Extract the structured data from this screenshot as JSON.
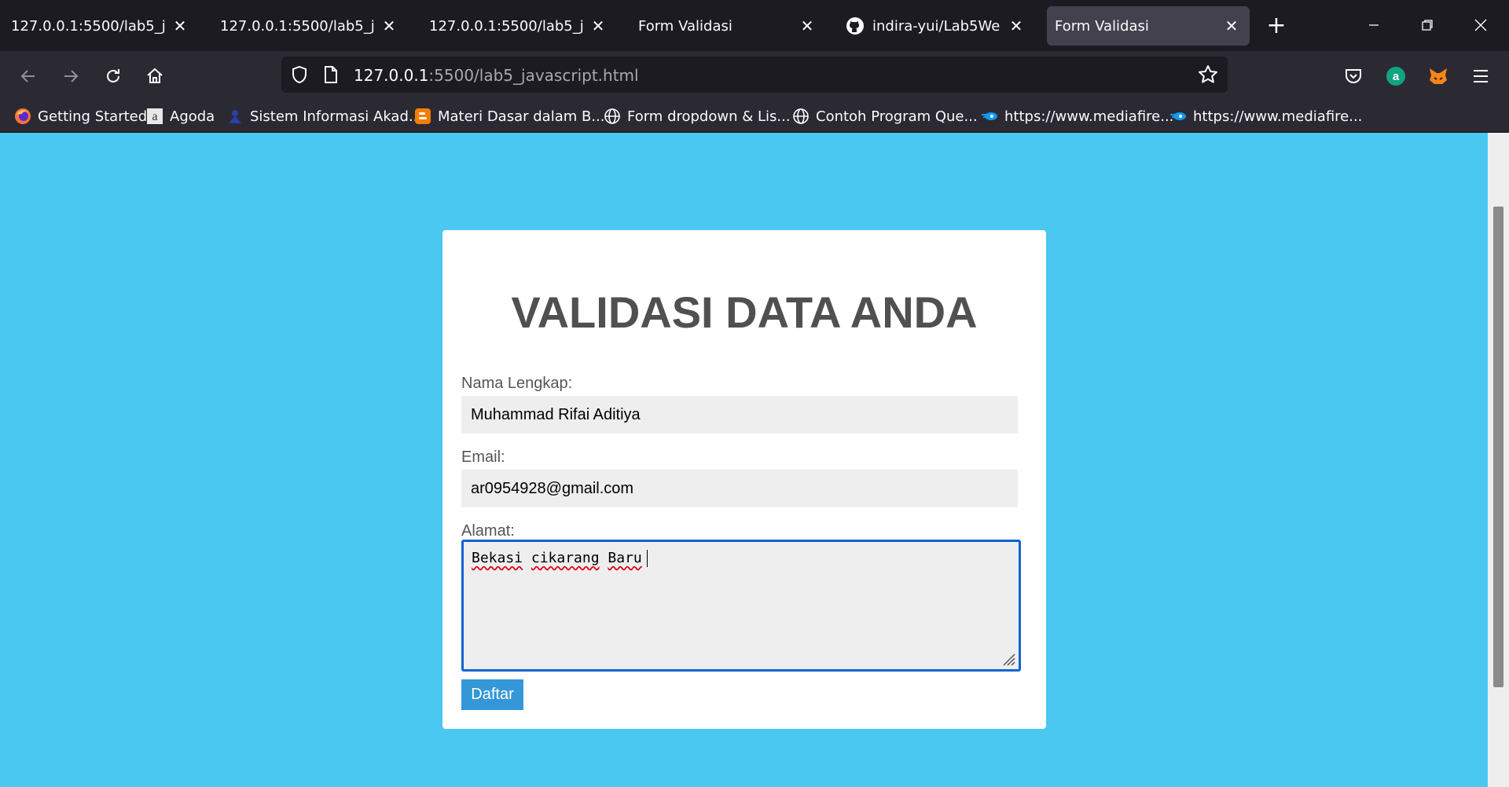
{
  "browser": {
    "tabs": [
      {
        "label": "127.0.0.1:5500/lab5_javascript.html",
        "active": false
      },
      {
        "label": "127.0.0.1:5500/lab5_javascript.html",
        "active": false
      },
      {
        "label": "127.0.0.1:5500/lab5_javascript.html",
        "active": false
      },
      {
        "label": "Form Validasi",
        "active": false
      },
      {
        "label": "indira-yui/Lab5Web",
        "active": false
      },
      {
        "label": "Form Validasi",
        "active": true
      }
    ],
    "url_host": "127.0.0.1",
    "url_rest": ":5500/lab5_javascript.html",
    "bookmarks": [
      {
        "label": "Getting Started",
        "icon": "firefox-icon"
      },
      {
        "label": "Agoda",
        "icon": "agoda-icon"
      },
      {
        "label": "Sistem Informasi Akad...",
        "icon": "university-icon"
      },
      {
        "label": "Materi Dasar dalam B...",
        "icon": "blogger-icon"
      },
      {
        "label": "Form dropdown & Lis...",
        "icon": "globe-icon"
      },
      {
        "label": "Contoh Program Que...",
        "icon": "globe-icon"
      },
      {
        "label": "https://www.mediafire...",
        "icon": "mediafire-icon"
      },
      {
        "label": "https://www.mediafire...",
        "icon": "mediafire-icon"
      }
    ],
    "colors": {
      "chrome_dark": "#1c1b22",
      "chrome": "#2b2a33",
      "active_tab": "#42414d"
    }
  },
  "page": {
    "background": "#4ac8f1",
    "title": "VALIDASI DATA ANDA",
    "form": {
      "name_label": "Nama Lengkap:",
      "name_value": "Muhammad Rifai Aditiya",
      "email_label": "Email:",
      "email_value": "ar0954928@gmail.com",
      "address_label": "Alamat:",
      "address_words": [
        "Bekasi",
        "cikarang",
        "Baru"
      ],
      "submit_label": "Daftar",
      "submit_color": "#3497d8",
      "focus_color": "#0a64d2"
    }
  }
}
